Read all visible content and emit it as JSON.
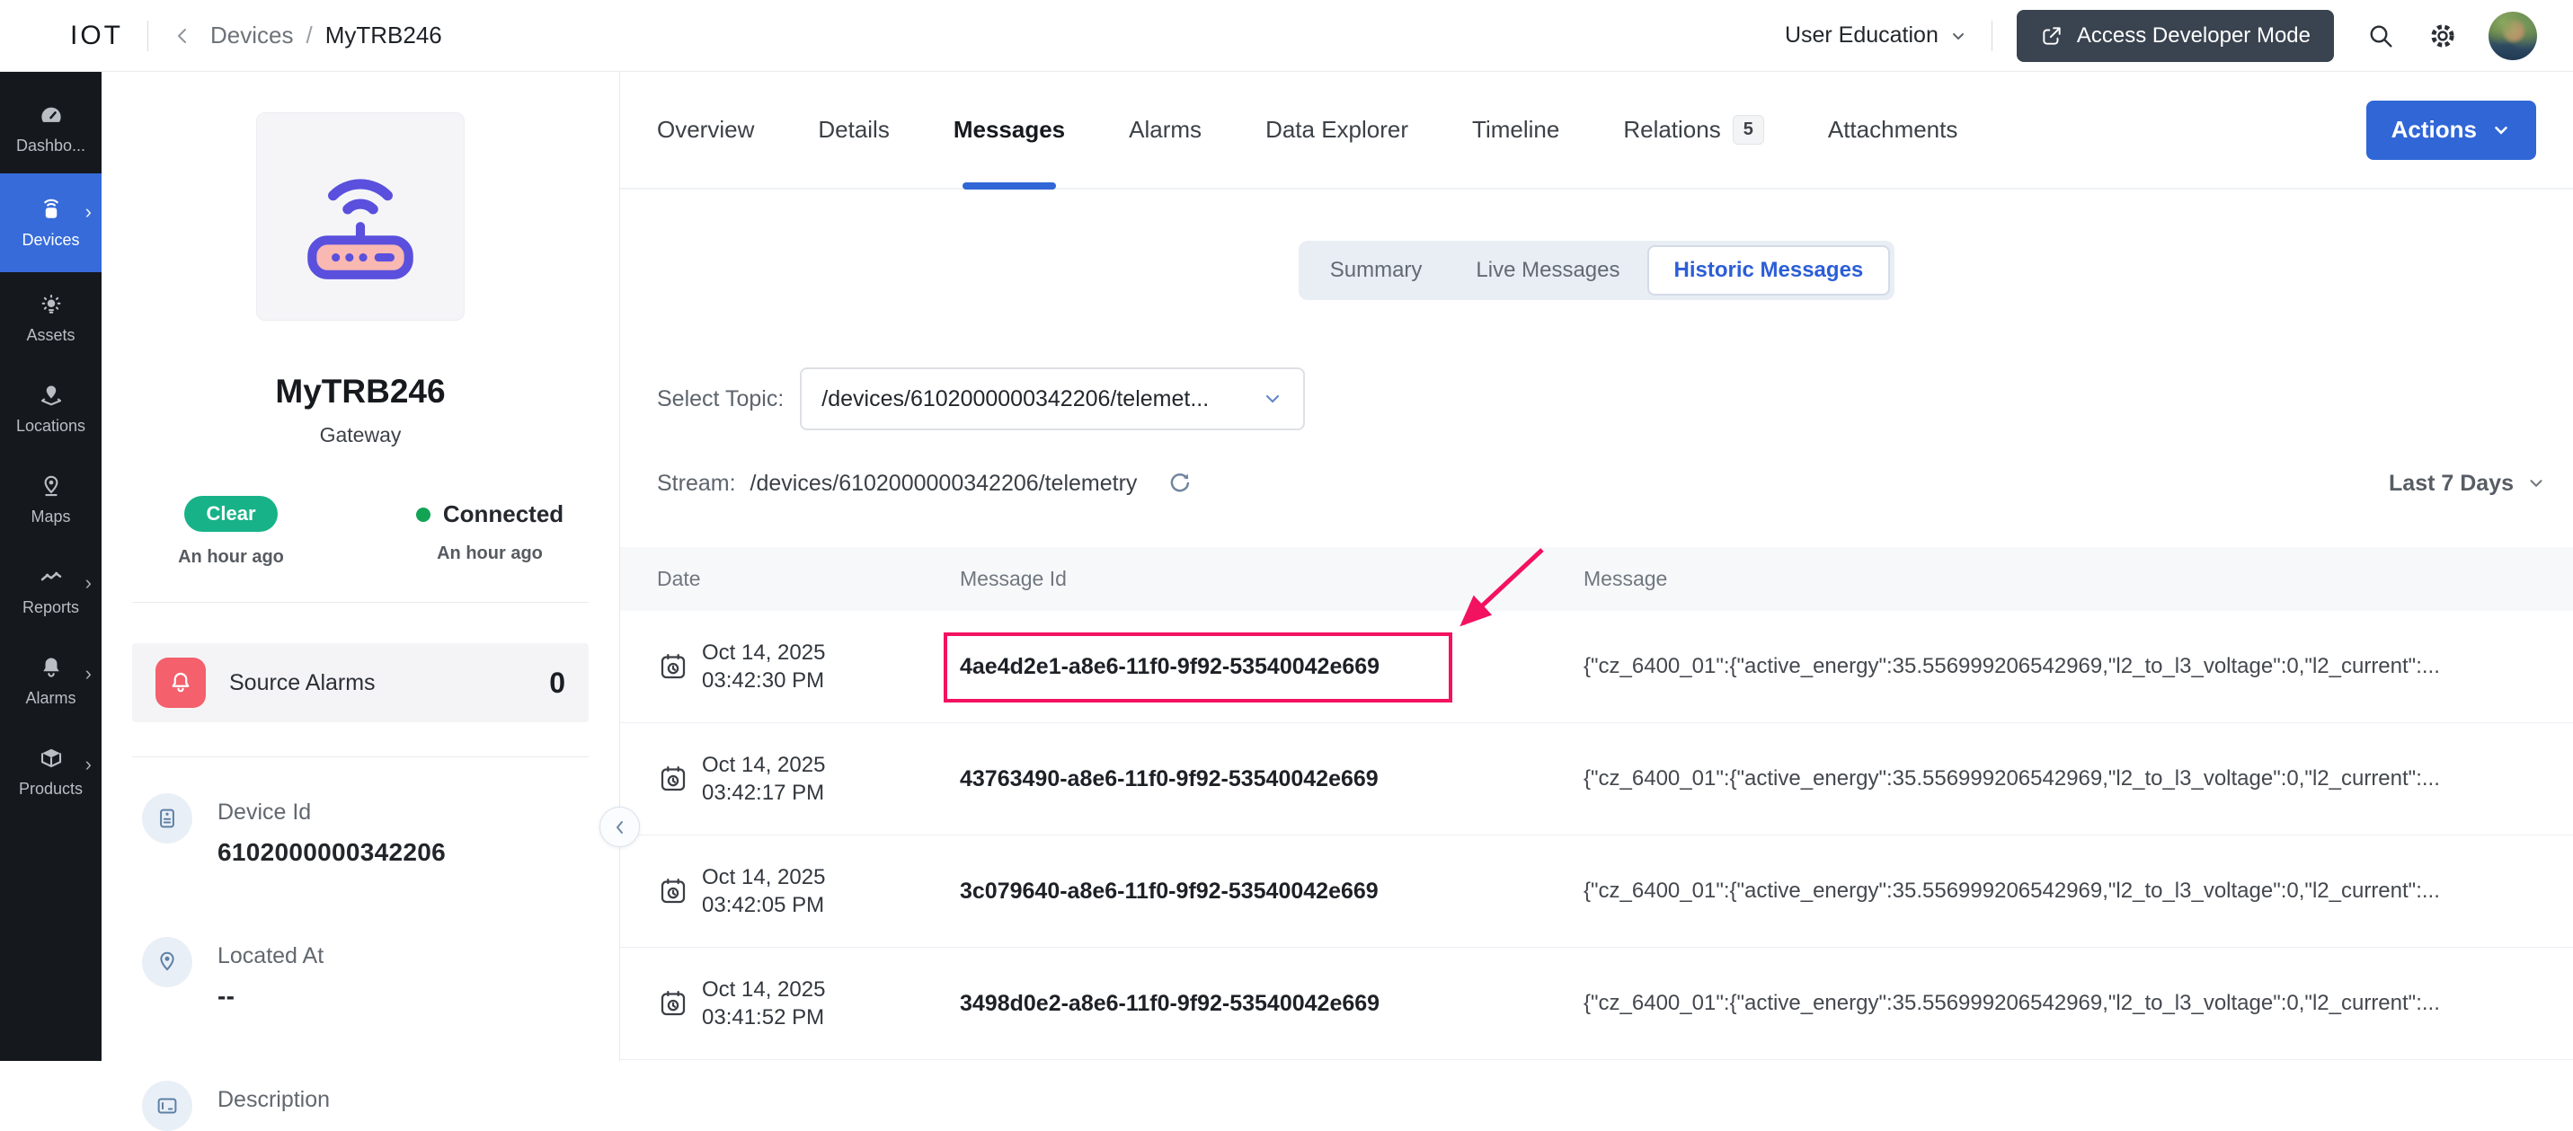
{
  "topbar": {
    "logo": "IOT",
    "breadcrumb_parent": "Devices",
    "breadcrumb_separator": "/",
    "breadcrumb_current": "MyTRB246",
    "user_menu_label": "User Education",
    "developer_mode_label": "Access Developer Mode"
  },
  "sidebar": {
    "items": [
      {
        "label": "Dashbo...",
        "icon": "dashboard-gauge-icon",
        "active": false,
        "expandable": false
      },
      {
        "label": "Devices",
        "icon": "devices-icon",
        "active": true,
        "expandable": true
      },
      {
        "label": "Assets",
        "icon": "assets-bulb-icon",
        "active": false,
        "expandable": false
      },
      {
        "label": "Locations",
        "icon": "locations-icon",
        "active": false,
        "expandable": false
      },
      {
        "label": "Maps",
        "icon": "maps-pin-icon",
        "active": false,
        "expandable": false
      },
      {
        "label": "Reports",
        "icon": "reports-chart-icon",
        "active": false,
        "expandable": true
      },
      {
        "label": "Alarms",
        "icon": "alarms-bell-icon",
        "active": false,
        "expandable": true
      },
      {
        "label": "Products",
        "icon": "products-box-icon",
        "active": false,
        "expandable": true
      }
    ]
  },
  "device_panel": {
    "name": "MyTRB246",
    "type": "Gateway",
    "alarm_state_badge": "Clear",
    "alarm_state_updated": "An hour ago",
    "connection_state": "Connected",
    "connection_updated": "An hour ago",
    "source_alarms": {
      "label": "Source Alarms",
      "count": "0"
    },
    "fields": [
      {
        "label": "Device Id",
        "value": "6102000000342206",
        "icon": "device-id-clipboard-icon"
      },
      {
        "label": "Located At",
        "value": "--",
        "icon": "location-pin-icon"
      },
      {
        "label": "Description",
        "value": "",
        "icon": "description-icon"
      }
    ]
  },
  "main": {
    "tabs": [
      {
        "label": "Overview"
      },
      {
        "label": "Details"
      },
      {
        "label": "Messages",
        "active": true
      },
      {
        "label": "Alarms"
      },
      {
        "label": "Data Explorer"
      },
      {
        "label": "Timeline"
      },
      {
        "label": "Relations",
        "badge": "5"
      },
      {
        "label": "Attachments"
      }
    ],
    "actions_button": "Actions",
    "subtabs": [
      {
        "label": "Summary"
      },
      {
        "label": "Live Messages"
      },
      {
        "label": "Historic Messages",
        "active": true
      }
    ],
    "select_topic": {
      "label": "Select Topic:",
      "value": "/devices/6102000000342206/telemet..."
    },
    "stream": {
      "label": "Stream:",
      "value": "/devices/6102000000342206/telemetry"
    },
    "time_range": "Last 7 Days",
    "table": {
      "columns": [
        "Date",
        "Message Id",
        "Message"
      ],
      "rows": [
        {
          "date_line1": "Oct 14, 2025",
          "date_line2": "03:42:30 PM",
          "message_id": "4ae4d2e1-a8e6-11f0-9f92-53540042e669",
          "message": "{\"cz_6400_01\":{\"active_energy\":35.556999206542969,\"l2_to_l3_voltage\":0,\"l2_current\":...",
          "highlighted": true
        },
        {
          "date_line1": "Oct 14, 2025",
          "date_line2": "03:42:17 PM",
          "message_id": "43763490-a8e6-11f0-9f92-53540042e669",
          "message": "{\"cz_6400_01\":{\"active_energy\":35.556999206542969,\"l2_to_l3_voltage\":0,\"l2_current\":...",
          "highlighted": false
        },
        {
          "date_line1": "Oct 14, 2025",
          "date_line2": "03:42:05 PM",
          "message_id": "3c079640-a8e6-11f0-9f92-53540042e669",
          "message": "{\"cz_6400_01\":{\"active_energy\":35.556999206542969,\"l2_to_l3_voltage\":0,\"l2_current\":...",
          "highlighted": false
        },
        {
          "date_line1": "Oct 14, 2025",
          "date_line2": "03:41:52 PM",
          "message_id": "3498d0e2-a8e6-11f0-9f92-53540042e669",
          "message": "{\"cz_6400_01\":{\"active_energy\":35.556999206542969,\"l2_to_l3_voltage\":0,\"l2_current\":...",
          "highlighted": false
        }
      ]
    }
  },
  "colors": {
    "accent_blue": "#3066d6",
    "sidebar_bg": "#15181d",
    "sidebar_active": "#366bd9",
    "badge_green": "#17b288",
    "connected_green": "#12a454",
    "alarm_red": "#f4606b",
    "annotation_pink": "#f31260",
    "table_header_bg": "#f7f8fa",
    "router_indigo": "#5a50dd",
    "router_pink": "#f9b8b1"
  }
}
